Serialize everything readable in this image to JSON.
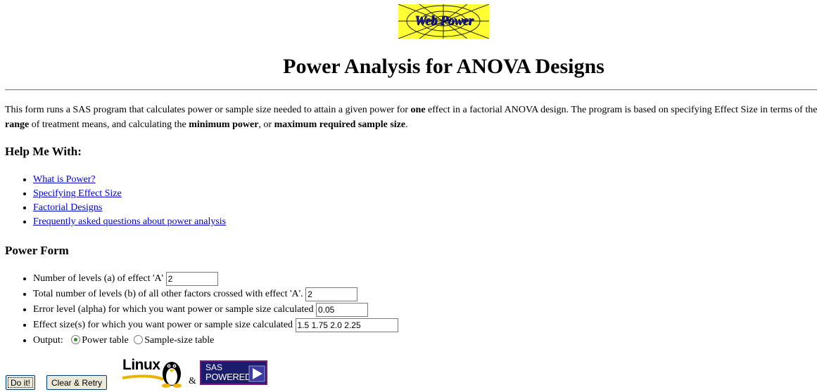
{
  "logo": {
    "text": "Web Power",
    "bg": "#ffff33",
    "fg": "#1a1aa6"
  },
  "page_title": "Power Analysis for ANOVA Designs",
  "intro": {
    "p1_a": "This form runs a SAS program that calculates power or sample size needed to attain a given power for ",
    "p1_b": "one",
    "p1_c": " effect in a factorial ANOVA design. The program is based on specifying Effect Size in terms of the",
    "p2_a": "range",
    "p2_b": " of treatment means, and calculating the ",
    "p2_c": "minimum power",
    "p2_d": ", or ",
    "p2_e": "maximum required sample size",
    "p2_f": "."
  },
  "help": {
    "heading": "Help Me With:",
    "items": [
      {
        "label": "What is Power?"
      },
      {
        "label": "Specifying Effect Size"
      },
      {
        "label": "Factorial Designs"
      },
      {
        "label": "Frequently asked questions about power analysis"
      }
    ]
  },
  "form": {
    "heading": "Power Form",
    "levels_a": {
      "label": "Number of levels (a) of effect 'A'",
      "value": "2"
    },
    "levels_b": {
      "label": "Total number of levels (b) of all other factors crossed with effect 'A'.",
      "value": "2"
    },
    "alpha": {
      "label": "Error level (alpha) for which you want power or sample size calculated",
      "value": "0.05"
    },
    "effect": {
      "label": "Effect size(s) for which you want power or sample size calculated",
      "value": "1.5 1.75 2.0 2.25"
    },
    "output": {
      "label": "Output:",
      "options": [
        {
          "label": "Power table",
          "selected": true
        },
        {
          "label": "Sample-size table",
          "selected": false
        }
      ]
    }
  },
  "buttons": {
    "do_it": "Do it!",
    "clear": "Clear & Retry"
  },
  "badges": {
    "linux": "Linux",
    "amp": "&",
    "sas_1": "SAS",
    "sas_2": "POWERED"
  }
}
